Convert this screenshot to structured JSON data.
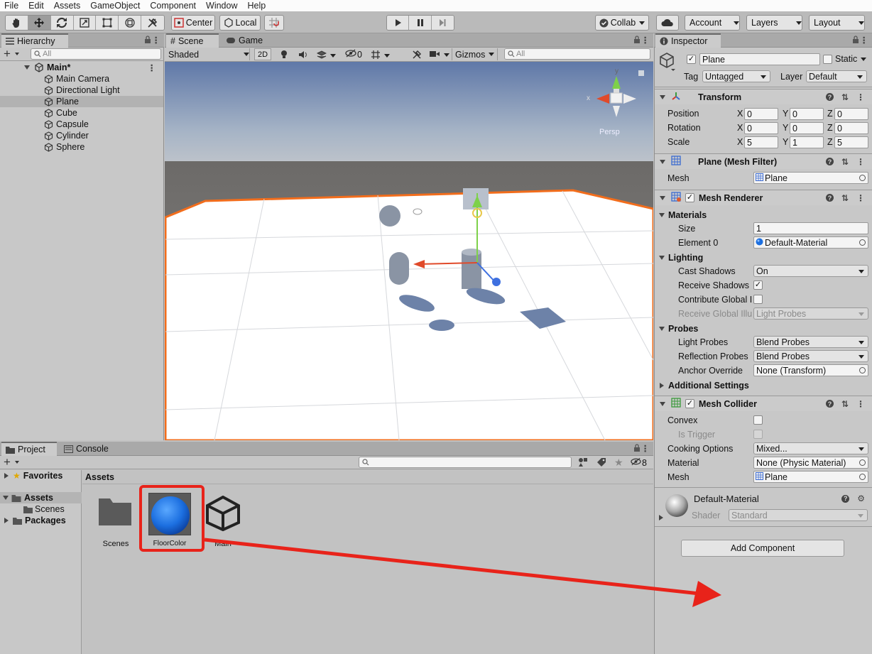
{
  "menu": [
    "File",
    "Edit",
    "Assets",
    "GameObject",
    "Component",
    "Window",
    "Help"
  ],
  "toolbar": {
    "pivot": "Center",
    "space": "Local",
    "collab": "Collab",
    "account": "Account",
    "layers": "Layers",
    "layout": "Layout"
  },
  "hierarchy": {
    "tab": "Hierarchy",
    "search_placeholder": "All",
    "scene": "Main*",
    "items": [
      "Main Camera",
      "Directional Light",
      "Plane",
      "Cube",
      "Capsule",
      "Cylinder",
      "Sphere"
    ]
  },
  "scene": {
    "tabs": [
      "Scene",
      "Game"
    ],
    "shading": "Shaded",
    "mode_2d": "2D",
    "hidden_count": "0",
    "gizmos": "Gizmos",
    "search_placeholder": "All",
    "persp": "Persp",
    "axis_x": "x",
    "axis_y": "y"
  },
  "project": {
    "tabs": [
      "Project",
      "Console"
    ],
    "hidden_count": "8",
    "tree": {
      "favorites": "Favorites",
      "assets": "Assets",
      "scenes": "Scenes",
      "packages": "Packages"
    },
    "breadcrumb": "Assets",
    "assets": [
      "Scenes",
      "FloorColor",
      "Main"
    ]
  },
  "inspector": {
    "tab": "Inspector",
    "object_name": "Plane",
    "static": "Static",
    "tag_label": "Tag",
    "tag": "Untagged",
    "layer_label": "Layer",
    "layer": "Default",
    "transform": {
      "title": "Transform",
      "axes": [
        "X",
        "Y",
        "Z"
      ],
      "position_label": "Position",
      "position": [
        "0",
        "0",
        "0"
      ],
      "rotation_label": "Rotation",
      "rotation": [
        "0",
        "0",
        "0"
      ],
      "scale_label": "Scale",
      "scale": [
        "5",
        "1",
        "5"
      ]
    },
    "mesh_filter": {
      "title": "Plane (Mesh Filter)",
      "mesh_label": "Mesh",
      "mesh": "Plane"
    },
    "mesh_renderer": {
      "title": "Mesh Renderer",
      "materials": "Materials",
      "size_label": "Size",
      "size": "1",
      "element0_label": "Element 0",
      "element0": "Default-Material",
      "lighting": "Lighting",
      "cast_shadows_label": "Cast Shadows",
      "cast_shadows": "On",
      "receive_shadows_label": "Receive Shadows",
      "contribute_gi_label": "Contribute Global I",
      "receive_gi_label": "Receive Global Illu",
      "receive_gi": "Light Probes",
      "probes": "Probes",
      "light_probes_label": "Light Probes",
      "light_probes": "Blend Probes",
      "reflection_probes_label": "Reflection Probes",
      "reflection_probes": "Blend Probes",
      "anchor_override_label": "Anchor Override",
      "anchor_override": "None (Transform)",
      "additional": "Additional Settings"
    },
    "mesh_collider": {
      "title": "Mesh Collider",
      "convex_label": "Convex",
      "is_trigger_label": "Is Trigger",
      "cooking_label": "Cooking Options",
      "cooking": "Mixed...",
      "material_label": "Material",
      "material": "None (Physic Material)",
      "mesh_label": "Mesh",
      "mesh": "Plane"
    },
    "material": {
      "name": "Default-Material",
      "shader_label": "Shader",
      "shader": "Standard"
    },
    "add_component": "Add Component"
  },
  "colors": {
    "highlight_box": "#e8231a",
    "arrow": "#e8231a",
    "selection_outline": "#f26d1c",
    "material_blue": "#1c6fe0"
  }
}
